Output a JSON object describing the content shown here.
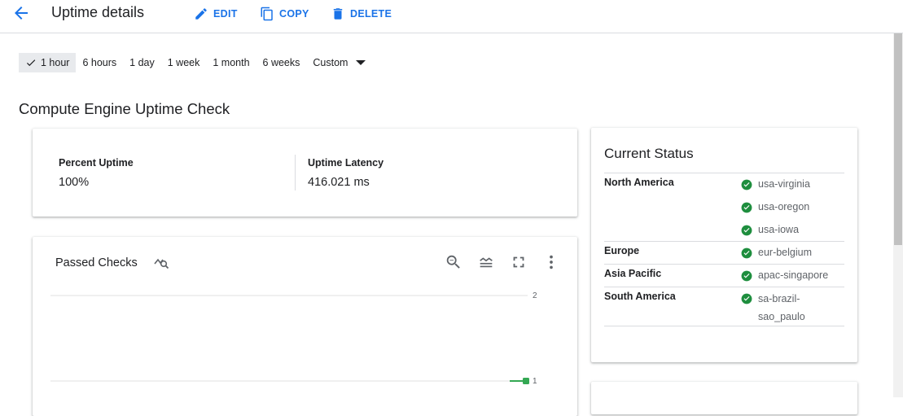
{
  "header": {
    "title": "Uptime details",
    "actions": {
      "edit": "EDIT",
      "copy": "COPY",
      "delete": "DELETE"
    }
  },
  "time_range": {
    "options": [
      "1 hour",
      "6 hours",
      "1 day",
      "1 week",
      "1 month",
      "6 weeks",
      "Custom"
    ],
    "selected": "1 hour"
  },
  "section_title": "Compute Engine Uptime Check",
  "metrics": {
    "percent_uptime": {
      "label": "Percent Uptime",
      "value": "100%"
    },
    "uptime_latency": {
      "label": "Uptime Latency",
      "value": "416.021 ms"
    }
  },
  "chart": {
    "title": "Passed Checks",
    "y_ticks": [
      "2",
      "1"
    ]
  },
  "chart_data": {
    "type": "line",
    "title": "Passed Checks",
    "series": [
      {
        "values": [
          1,
          1
        ]
      }
    ],
    "y_ticks": [
      2,
      1
    ],
    "color": "#34a853"
  },
  "status": {
    "title": "Current Status",
    "regions": [
      {
        "name": "North America",
        "locations": [
          "usa-virginia",
          "usa-oregon",
          "usa-iowa"
        ]
      },
      {
        "name": "Europe",
        "locations": [
          "eur-belgium"
        ]
      },
      {
        "name": "Asia Pacific",
        "locations": [
          "apac-singapore"
        ]
      },
      {
        "name": "South America",
        "locations": [
          "sa-brazil-\nsao_paulo"
        ]
      }
    ],
    "ok_color": "#1e8e3e"
  },
  "colors": {
    "accent": "#1a73e8",
    "ok": "#1e8e3e",
    "series": "#34a853"
  }
}
